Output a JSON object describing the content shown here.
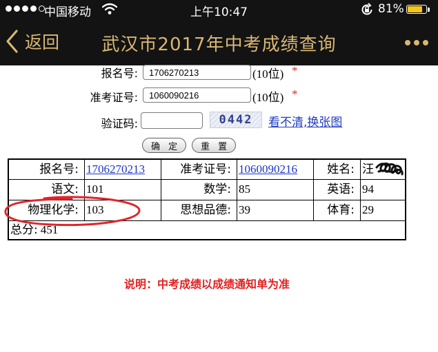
{
  "status_bar": {
    "carrier": "中国移动",
    "time": "上午10:47",
    "battery_percent": "81%",
    "battery_level": 0.81,
    "battery_color": "#f5c518"
  },
  "nav": {
    "back_label": "返回",
    "title": "武汉市2017年中考成绩查询",
    "accent_color": "#d9b772"
  },
  "form": {
    "registration": {
      "label": "报名号:",
      "value": "1706270213",
      "hint": "(10位)",
      "required_mark": "*"
    },
    "exam_ticket": {
      "label": "准考证号:",
      "value": "1060090216",
      "hint": "(10位)",
      "required_mark": "*"
    },
    "captcha": {
      "label": "验证码:",
      "value": "",
      "image_text": "0442",
      "refresh_link": "看不清,换张图"
    },
    "confirm_button": "确 定",
    "reset_button": "重 置"
  },
  "results": {
    "rows": [
      [
        {
          "label": "报名号:",
          "value": "1706270213"
        },
        {
          "label": "准考证号:",
          "value": "1060090216"
        },
        {
          "label": "姓名:",
          "value": "汪"
        }
      ],
      [
        {
          "label": "语文:",
          "value": "101"
        },
        {
          "label": "数学:",
          "value": "85"
        },
        {
          "label": "英语:",
          "value": "94"
        }
      ],
      [
        {
          "label": "物理化学:",
          "value": "103"
        },
        {
          "label": "思想品德:",
          "value": "39"
        },
        {
          "label": "体育:",
          "value": "29"
        }
      ]
    ],
    "total": {
      "label": "总分:",
      "value": "451"
    }
  },
  "note": "说明：中考成绩以成绩通知单为准",
  "colors": {
    "annotation": "#e0242a",
    "link": "#1a35c8",
    "note": "#e31f1f"
  }
}
